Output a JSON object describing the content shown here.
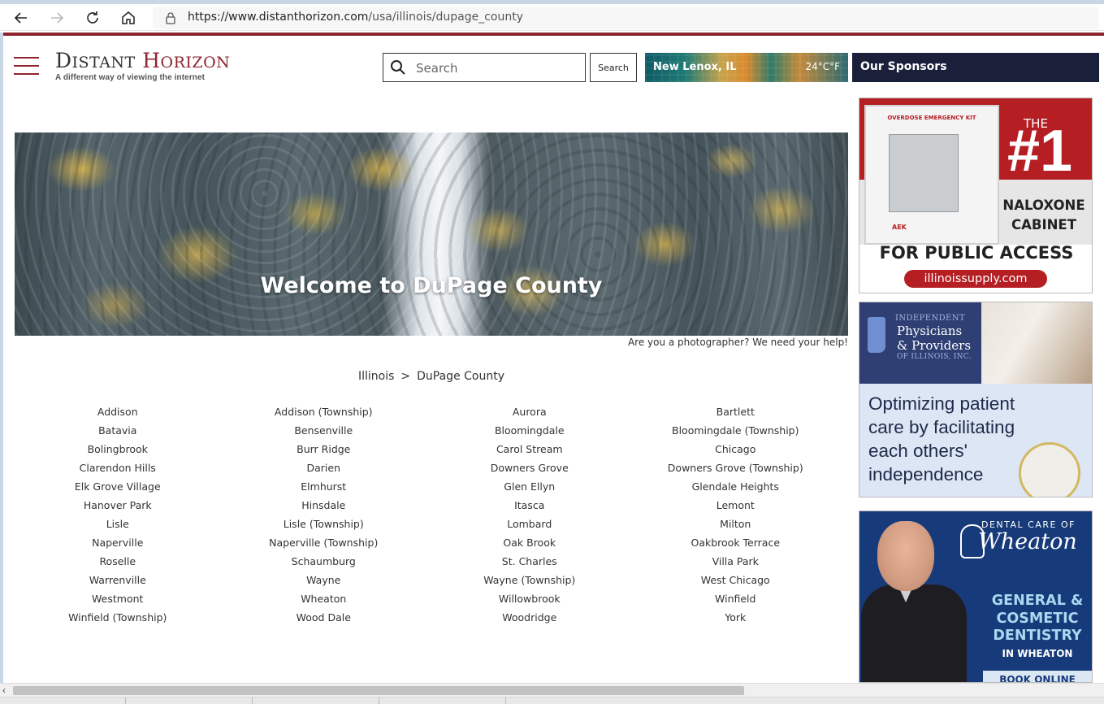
{
  "browser": {
    "url_host": "https://www.distanthorizon.com",
    "url_path": "/usa/illinois/dupage_county"
  },
  "header": {
    "brand_d": "D",
    "brand_istant": "ISTANT",
    "brand_h": "H",
    "brand_orizon": "ORIZON",
    "tagline": "A different way of viewing the internet",
    "search_placeholder": "Search",
    "search_button": "Search",
    "weather_city": "New Lenox, IL",
    "weather_temp": "24°C°F",
    "sponsors_label": "Our Sponsors"
  },
  "hero": {
    "title": "Welcome to DuPage County",
    "photo_note": "Are you a photographer?  We need your help!"
  },
  "breadcrumb": {
    "state": "Illinois",
    "separator": ">",
    "county": "DuPage County"
  },
  "places": [
    "Addison",
    "Addison (Township)",
    "Aurora",
    "Bartlett",
    "Batavia",
    "Bensenville",
    "Bloomingdale",
    "Bloomingdale (Township)",
    "Bolingbrook",
    "Burr Ridge",
    "Carol Stream",
    "Chicago",
    "Clarendon Hills",
    "Darien",
    "Downers Grove",
    "Downers Grove (Township)",
    "Elk Grove Village",
    "Elmhurst",
    "Glen Ellyn",
    "Glendale Heights",
    "Hanover Park",
    "Hinsdale",
    "Itasca",
    "Lemont",
    "Lisle",
    "Lisle (Township)",
    "Lombard",
    "Milton",
    "Naperville",
    "Naperville (Township)",
    "Oak Brook",
    "Oakbrook Terrace",
    "Roselle",
    "Schaumburg",
    "St. Charles",
    "Villa Park",
    "Warrenville",
    "Wayne",
    "Wayne (Township)",
    "West Chicago",
    "Westmont",
    "Wheaton",
    "Willowbrook",
    "Winfield",
    "Winfield (Township)",
    "Wood Dale",
    "Woodridge",
    "York"
  ],
  "ads": {
    "ad1": {
      "kit_label": "OVERDOSE EMERGENCY KIT",
      "brand": "AEK",
      "the": "THE",
      "number": "#1",
      "product_line1": "NALOXONE",
      "product_line2": "CABINET",
      "public": "FOR PUBLIC ACCESS",
      "url": "illinoissupply.com"
    },
    "ad2": {
      "independent": "INDEPENDENT",
      "physicians": "Physicians",
      "providers": "& Providers",
      "of_illinois": "OF ILLINOIS, INC.",
      "message": "Optimizing patient care by facilitating each others' independence"
    },
    "ad3": {
      "dental_care_of": "DENTAL CARE OF",
      "wheaton": "Wheaton",
      "services_line1": "GENERAL &",
      "services_line2": "COSMETIC",
      "services_line3": "DENTISTRY",
      "in_wheaton": "IN WHEATON",
      "book_online": "BOOK ONLINE"
    }
  }
}
